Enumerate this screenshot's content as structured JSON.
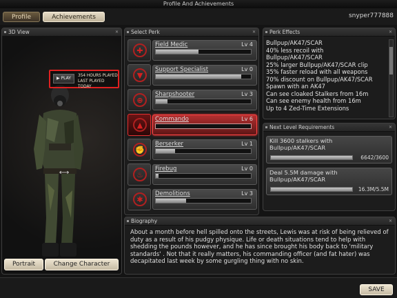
{
  "window": {
    "title": "Profile And Achievements"
  },
  "tabs": [
    {
      "label": "Profile"
    },
    {
      "label": "Achievements"
    }
  ],
  "user": {
    "name": "snyper777888"
  },
  "view": {
    "header": "3D View",
    "play_label": "PLAY",
    "hours_played": "354 HOURS PLAYED",
    "last_played": "LAST PLAYED TODAY",
    "portrait_label": "Portrait",
    "change_character_label": "Change Character"
  },
  "perks": {
    "header": "Select Perk",
    "items": [
      {
        "name": "Field Medic",
        "level": "Lv 4",
        "progress": 0.45,
        "icon": "medic-cross-icon",
        "glyph": "✚"
      },
      {
        "name": "Support Specialist",
        "level": "Lv 0",
        "progress": 0.9,
        "icon": "support-icon",
        "glyph": "▼"
      },
      {
        "name": "Sharpshooter",
        "level": "Lv 3",
        "progress": 0.12,
        "icon": "crosshair-icon",
        "glyph": "⊕"
      },
      {
        "name": "Commando",
        "level": "Lv 6",
        "progress": 0.0,
        "icon": "commando-chevron-icon",
        "glyph": "▲"
      },
      {
        "name": "Berserker",
        "level": "Lv 1",
        "progress": 0.2,
        "icon": "berserker-fist-icon",
        "glyph": "✊"
      },
      {
        "name": "Firebug",
        "level": "Lv 0",
        "progress": 0.03,
        "icon": "flame-icon",
        "glyph": "♨"
      },
      {
        "name": "Demolitions",
        "level": "Lv 3",
        "progress": 0.32,
        "icon": "explosive-icon",
        "glyph": "✱"
      }
    ],
    "selected_index": 3
  },
  "effects": {
    "header": "Perk Effects",
    "lines": [
      "Bullpup/AK47/SCAR",
      "40% less recoil with",
      "Bullpup/AK47/SCAR",
      "25% larger Bullpup/AK47/SCAR clip",
      "35% faster reload with all weapons",
      "70% discount on Bullpup/AK47/SCAR",
      "Spawn with an AK47",
      "Can see cloaked Stalkers from 16m",
      "Can see enemy health from 16m",
      "Up to 4 Zed-Time Extensions"
    ]
  },
  "next_level": {
    "header": "Next Level Requirements",
    "items": [
      {
        "text": "Kill 3600 stalkers with Bullpup/AK47/SCAR",
        "progress": 1.0,
        "value": "6642/3600"
      },
      {
        "text": "Deal 5.5M damage with Bullpup/AK47/SCAR",
        "progress": 1.0,
        "value": "16.3M/5.5M"
      }
    ]
  },
  "bio": {
    "header": "Biography",
    "text": "About a month before hell spilled onto the streets, Lewis was at risk of being relieved of duty as a result of his pudgy physique. Life or death situations tend to help with shedding the pounds however, and he has since brought his body back to 'military standards' .  Not that it really matters, his commanding officer (and fat hater) was decapitated last week by some gurgling thing with no skin."
  },
  "footer": {
    "save_label": "SAVE"
  },
  "colors": {
    "accent": "#e02020",
    "button_cream": "#e6dcc7"
  }
}
